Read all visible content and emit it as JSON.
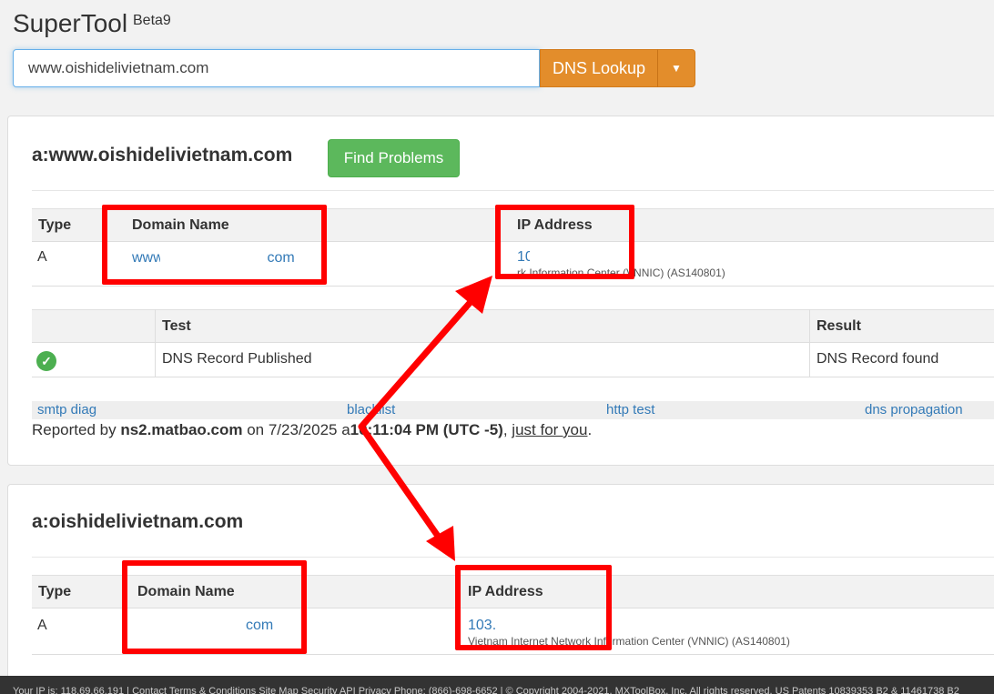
{
  "app": {
    "title": "SuperTool",
    "badge": "Beta9"
  },
  "search": {
    "value": "www.oishidelivietnam.com",
    "button_label": "DNS Lookup"
  },
  "result1": {
    "title": "a:www.oishidelivietnam.com",
    "find_problems_label": "Find Problems",
    "record_table": {
      "headers": [
        "Type",
        "Domain Name",
        "IP Address"
      ],
      "row": {
        "type": "A",
        "domain_start": "www",
        "domain_end": ".com",
        "ip": "10",
        "ip_org_visible": "rk Information Center (VNNIC) (AS140801)"
      }
    },
    "test_table": {
      "headers": [
        "",
        "Test",
        "Result"
      ],
      "row": {
        "test": "DNS Record Published",
        "result": "DNS Record found"
      }
    },
    "links": [
      "smtp diag",
      "blacklist",
      "http test",
      "dns propagation"
    ],
    "report": {
      "prefix": "Reported by ",
      "server": "ns2.matbao.com",
      "on": " on 7/23/2025 a",
      "time": "10:11:04 PM (UTC -5)",
      "sep": ", ",
      "link": "just for you",
      "end": "."
    }
  },
  "result2": {
    "title": "a:oishidelivietnam.com",
    "record_table": {
      "headers": [
        "Type",
        "Domain Name",
        "IP Address"
      ],
      "row": {
        "type": "A",
        "domain_end": "com",
        "ip": "103.",
        "ip_org": "Vietnam Internet Network Information Center (VNNIC) (AS140801)"
      }
    }
  },
  "footer": {
    "text": "Your IP is: 118.69.66.191 |  Contact Terms & Conditions Site Map Security API Privacy Phone: (866)-698-6652 |  © Copyright 2004-2021, MXToolBox, Inc, All rights reserved. US Patents 10839353 B2 & 11461738 B2"
  },
  "colors": {
    "accent_orange": "#e38d2b",
    "success_green": "#5cb85c",
    "link_blue": "#337ab7",
    "annotation_red": "#ff0000"
  },
  "icons": {
    "dropdown": "caret-down-icon",
    "status": "check-circle-icon"
  }
}
